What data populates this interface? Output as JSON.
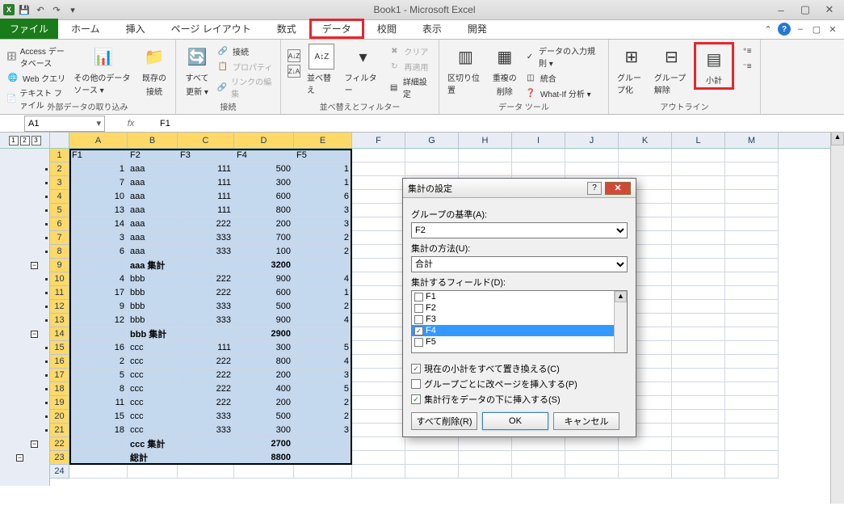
{
  "title": "Book1 - Microsoft Excel",
  "qat": {
    "excel": "X",
    "save": "💾",
    "undo": "↶",
    "redo": "↷",
    "more": "▾"
  },
  "win": {
    "min": "–",
    "max": "▢",
    "close": "✕"
  },
  "tabs": {
    "file": "ファイル",
    "home": "ホーム",
    "insert": "挿入",
    "pagelayout": "ページ レイアウト",
    "formulas": "数式",
    "data": "データ",
    "review": "校閲",
    "view": "表示",
    "dev": "開発"
  },
  "ribbon": {
    "ext_access": "Access データベース",
    "ext_web": "Web クエリ",
    "ext_text": "テキスト ファイル",
    "ext_other": "その他のデータ ソース ▾",
    "ext_existing1": "既存の",
    "ext_existing2": "接続",
    "ext_group": "外部データの取り込み",
    "refresh1": "すべて",
    "refresh2": "更新 ▾",
    "conn": "接続",
    "prop": "プロパティ",
    "editlinks": "リンクの編集",
    "conn_group": "接続",
    "sort_az": "A↓Z",
    "sort_za": "Z↓A",
    "sort": "並べ替え",
    "filter": "フィルター",
    "clear": "クリア",
    "reapply": "再適用",
    "advanced": "詳細設定",
    "sort_group": "並べ替えとフィルター",
    "t2c1": "区切り位置",
    "dedup1": "重複の",
    "dedup2": "削除",
    "datav": "データの入力規則 ▾",
    "consol": "統合",
    "whatif": "What-If 分析 ▾",
    "datatools_group": "データ ツール",
    "group": "グループ化",
    "ungroup": "グループ解除",
    "subtotal": "小計",
    "outline_group": "アウトライン"
  },
  "namebox": "A1",
  "formula": "F1",
  "colw": {
    "A": 72,
    "B": 62,
    "C": 70,
    "D": 74,
    "E": 72,
    "rest": 66
  },
  "cols_sel": [
    "A",
    "B",
    "C",
    "D",
    "E"
  ],
  "cols_rest": [
    "F",
    "G",
    "H",
    "I",
    "J",
    "K",
    "L",
    "M"
  ],
  "headers": [
    "F1",
    "F2",
    "F3",
    "F4",
    "F5"
  ],
  "rows": [
    {
      "n": 2,
      "a": "1",
      "b": "aaa",
      "c": "111",
      "d": "500",
      "e": "1",
      "o": "dot"
    },
    {
      "n": 3,
      "a": "7",
      "b": "aaa",
      "c": "111",
      "d": "300",
      "e": "1",
      "o": "dot"
    },
    {
      "n": 4,
      "a": "10",
      "b": "aaa",
      "c": "111",
      "d": "600",
      "e": "6",
      "o": "dot"
    },
    {
      "n": 5,
      "a": "13",
      "b": "aaa",
      "c": "111",
      "d": "800",
      "e": "3",
      "o": "dot"
    },
    {
      "n": 6,
      "a": "14",
      "b": "aaa",
      "c": "222",
      "d": "200",
      "e": "3",
      "o": "dot"
    },
    {
      "n": 7,
      "a": "3",
      "b": "aaa",
      "c": "333",
      "d": "700",
      "e": "2",
      "o": "dot"
    },
    {
      "n": 8,
      "a": "6",
      "b": "aaa",
      "c": "333",
      "d": "100",
      "e": "2",
      "o": "dot"
    },
    {
      "n": 9,
      "a": "",
      "b": "aaa 集計",
      "c": "",
      "d": "3200",
      "e": "",
      "o": "minus",
      "bold": true
    },
    {
      "n": 10,
      "a": "4",
      "b": "bbb",
      "c": "222",
      "d": "900",
      "e": "4",
      "o": "dot"
    },
    {
      "n": 11,
      "a": "17",
      "b": "bbb",
      "c": "222",
      "d": "600",
      "e": "1",
      "o": "dot"
    },
    {
      "n": 12,
      "a": "9",
      "b": "bbb",
      "c": "333",
      "d": "500",
      "e": "2",
      "o": "dot"
    },
    {
      "n": 13,
      "a": "12",
      "b": "bbb",
      "c": "333",
      "d": "900",
      "e": "4",
      "o": "dot"
    },
    {
      "n": 14,
      "a": "",
      "b": "bbb 集計",
      "c": "",
      "d": "2900",
      "e": "",
      "o": "minus",
      "bold": true
    },
    {
      "n": 15,
      "a": "16",
      "b": "ccc",
      "c": "111",
      "d": "300",
      "e": "5",
      "o": "dot"
    },
    {
      "n": 16,
      "a": "2",
      "b": "ccc",
      "c": "222",
      "d": "800",
      "e": "4",
      "o": "dot"
    },
    {
      "n": 17,
      "a": "5",
      "b": "ccc",
      "c": "222",
      "d": "200",
      "e": "3",
      "o": "dot"
    },
    {
      "n": 18,
      "a": "8",
      "b": "ccc",
      "c": "222",
      "d": "400",
      "e": "5",
      "o": "dot"
    },
    {
      "n": 19,
      "a": "11",
      "b": "ccc",
      "c": "222",
      "d": "200",
      "e": "2",
      "o": "dot"
    },
    {
      "n": 20,
      "a": "15",
      "b": "ccc",
      "c": "333",
      "d": "500",
      "e": "2",
      "o": "dot"
    },
    {
      "n": 21,
      "a": "18",
      "b": "ccc",
      "c": "333",
      "d": "300",
      "e": "3",
      "o": "dot"
    },
    {
      "n": 22,
      "a": "",
      "b": "ccc 集計",
      "c": "",
      "d": "2700",
      "e": "",
      "o": "minus",
      "bold": true
    },
    {
      "n": 23,
      "a": "",
      "b": "総計",
      "c": "",
      "d": "8800",
      "e": "",
      "o": "minus2",
      "bold": true
    }
  ],
  "blank_row": 24,
  "outline_levels": [
    "1",
    "2",
    "3"
  ],
  "dialog": {
    "title": "集計の設定",
    "group_label": "グループの基準(A):",
    "group_val": "F2",
    "func_label": "集計の方法(U):",
    "func_val": "合計",
    "fields_label": "集計するフィールド(D):",
    "fields": [
      {
        "name": "F1",
        "checked": false
      },
      {
        "name": "F2",
        "checked": false
      },
      {
        "name": "F3",
        "checked": false
      },
      {
        "name": "F4",
        "checked": true,
        "selected": true
      },
      {
        "name": "F5",
        "checked": false
      }
    ],
    "chk_replace": "現在の小計をすべて置き換える(C)",
    "chk_replace_v": true,
    "chk_pagebreak": "グループごとに改ページを挿入する(P)",
    "chk_pagebreak_v": false,
    "chk_below": "集計行をデータの下に挿入する(S)",
    "chk_below_v": true,
    "btn_removeall": "すべて削除(R)",
    "btn_ok": "OK",
    "btn_cancel": "キャンセル"
  }
}
